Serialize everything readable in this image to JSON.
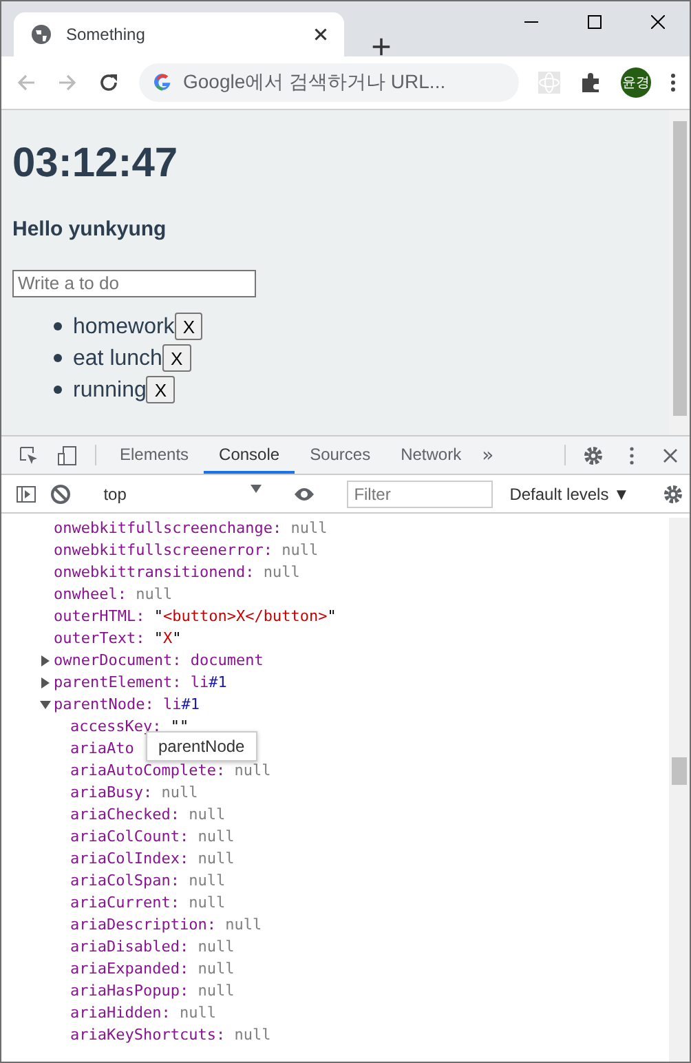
{
  "browser": {
    "tab_title": "Something",
    "address_placeholder": "Google에서 검색하거나 URL...",
    "profile": "윤경"
  },
  "page": {
    "clock": "03:12:47",
    "greeting": "Hello yunkyung",
    "todo_input": {
      "placeholder": "Write a to do"
    },
    "todos": [
      {
        "text": "homework",
        "button": "X"
      },
      {
        "text": "eat lunch",
        "button": "X"
      },
      {
        "text": "running",
        "button": "X"
      }
    ]
  },
  "devtools": {
    "tabs": [
      {
        "label": "Elements",
        "selected": false
      },
      {
        "label": "Console",
        "selected": true
      },
      {
        "label": "Sources",
        "selected": false
      },
      {
        "label": "Network",
        "selected": false
      }
    ],
    "more": "»",
    "context": "top",
    "filter": {
      "placeholder": "Filter"
    },
    "levels": "Default levels ▼",
    "properties": [
      {
        "key": "onwebkitfullscreenchange:",
        "value": "null",
        "kind": "null"
      },
      {
        "key": "onwebkitfullscreenerror:",
        "value": "null",
        "kind": "null"
      },
      {
        "key": "onwebkittransitionend:",
        "value": "null",
        "kind": "null"
      },
      {
        "key": "onwheel:",
        "value": "null",
        "kind": "null"
      },
      {
        "key": "outerHTML:",
        "value": "\"<button>X</button>\"",
        "kind": "string"
      },
      {
        "key": "outerText:",
        "value": "\"X\"",
        "kind": "string"
      },
      {
        "key": "ownerDocument:",
        "value": "document",
        "kind": "object",
        "expanded": false
      },
      {
        "key": "parentElement:",
        "value": "li#1",
        "kind": "node",
        "expanded": false
      },
      {
        "key": "parentNode:",
        "value": "li#1",
        "kind": "node",
        "expanded": true,
        "children": [
          {
            "key": "accessKey:",
            "value": "\"\"",
            "kind": "string"
          },
          {
            "key": "ariaAto",
            "kind": "cut"
          },
          {
            "key": "ariaAutoComplete:",
            "value": "null",
            "kind": "null"
          },
          {
            "key": "ariaBusy:",
            "value": "null",
            "kind": "null"
          },
          {
            "key": "ariaChecked:",
            "value": "null",
            "kind": "null"
          },
          {
            "key": "ariaColCount:",
            "value": "null",
            "kind": "null"
          },
          {
            "key": "ariaColIndex:",
            "value": "null",
            "kind": "null"
          },
          {
            "key": "ariaColSpan:",
            "value": "null",
            "kind": "null"
          },
          {
            "key": "ariaCurrent:",
            "value": "null",
            "kind": "null"
          },
          {
            "key": "ariaDescription:",
            "value": "null",
            "kind": "null"
          },
          {
            "key": "ariaDisabled:",
            "value": "null",
            "kind": "null"
          },
          {
            "key": "ariaExpanded:",
            "value": "null",
            "kind": "null"
          },
          {
            "key": "ariaHasPopup:",
            "value": "null",
            "kind": "null"
          },
          {
            "key": "ariaHidden:",
            "value": "null",
            "kind": "null"
          },
          {
            "key": "ariaKeyShortcuts:",
            "value": "null",
            "kind": "null"
          }
        ]
      }
    ],
    "tooltip": "parentNode"
  }
}
